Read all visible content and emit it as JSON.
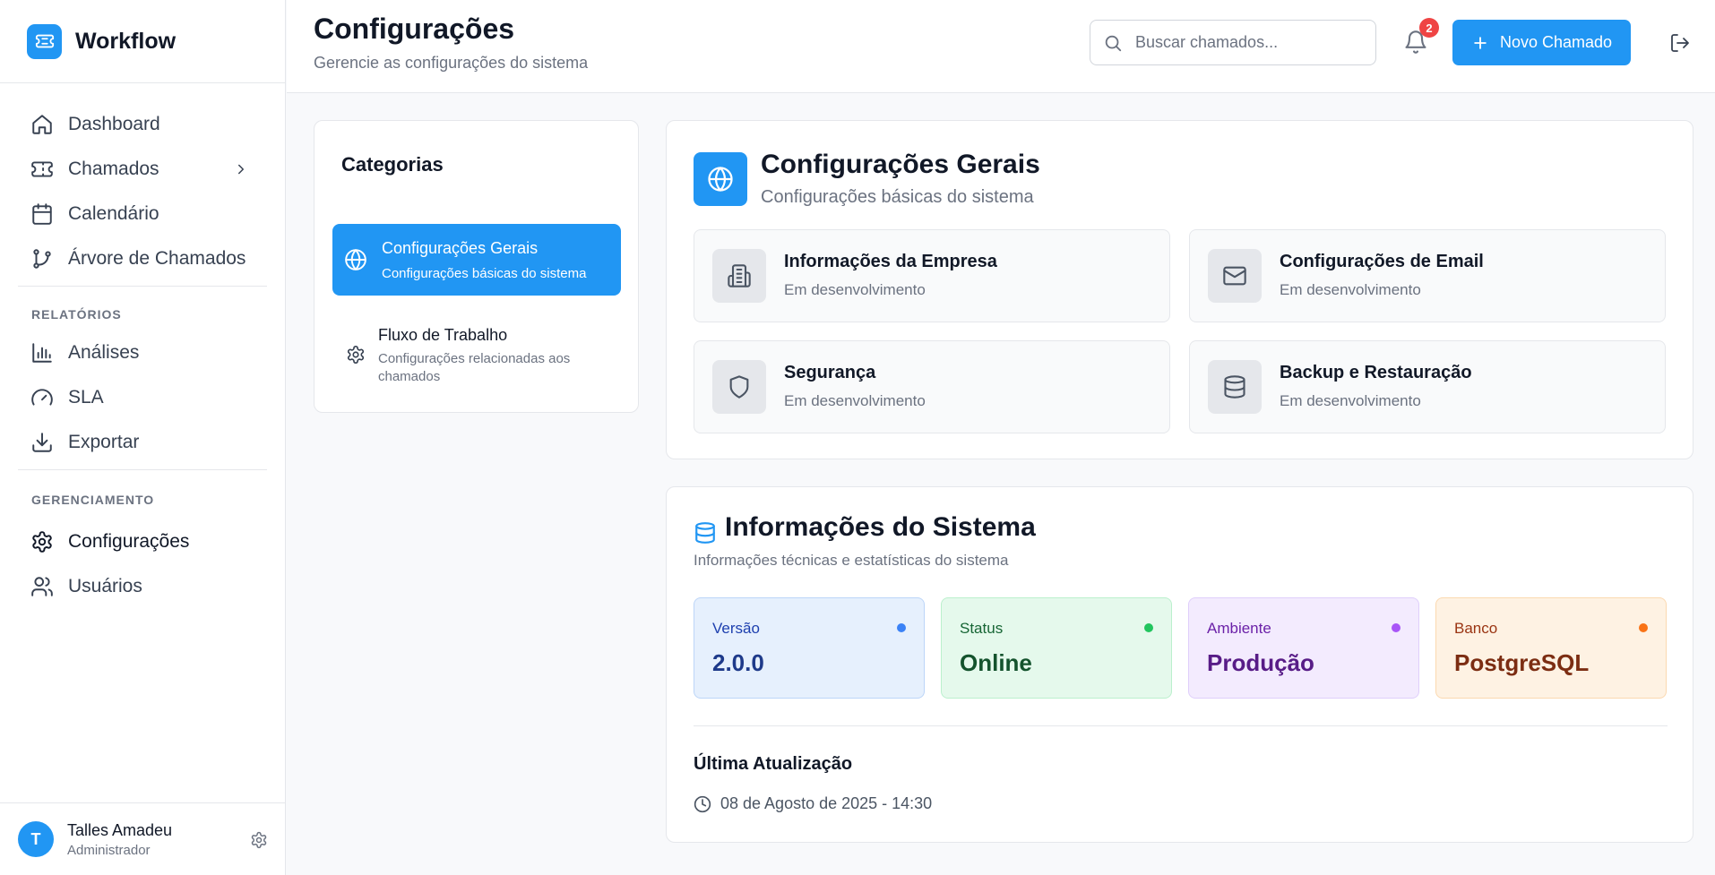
{
  "brand": {
    "name": "Workflow",
    "icon": "ticket-icon"
  },
  "sidebar": {
    "items": [
      {
        "label": "Dashboard",
        "icon": "home-icon"
      },
      {
        "label": "Chamados",
        "icon": "ticket-icon"
      },
      {
        "label": "Calendário",
        "icon": "calendar-icon"
      },
      {
        "label": "Árvore de Chamados",
        "icon": "git-branch-icon"
      }
    ],
    "reports_section": "RELATÓRIOS",
    "reports": [
      {
        "label": "Análises",
        "icon": "bar-chart-icon"
      },
      {
        "label": "SLA",
        "icon": "gauge-icon"
      },
      {
        "label": "Exportar",
        "icon": "download-icon"
      }
    ],
    "management_section": "GERENCIAMENTO",
    "management": [
      {
        "label": "Configurações",
        "icon": "gear-icon",
        "active": true
      },
      {
        "label": "Usuários",
        "icon": "users-icon"
      }
    ]
  },
  "user": {
    "initial": "T",
    "name": "Talles Amadeu",
    "role": "Administrador"
  },
  "header": {
    "title": "Configurações",
    "subtitle": "Gerencie as configurações do sistema",
    "search_placeholder": "Buscar chamados...",
    "notification_count": "2",
    "new_button": "Novo Chamado"
  },
  "categories": {
    "title": "Categorias",
    "items": [
      {
        "name": "Configurações Gerais",
        "desc": "Configurações básicas do sistema",
        "icon": "globe-icon",
        "active": true
      },
      {
        "name": "Fluxo de Trabalho",
        "desc": "Configurações relacionadas aos chamados",
        "icon": "gear-icon"
      }
    ]
  },
  "general": {
    "title": "Configurações Gerais",
    "subtitle": "Configurações básicas do sistema",
    "options": [
      {
        "title": "Informações da Empresa",
        "status": "Em desenvolvimento",
        "icon": "building-icon"
      },
      {
        "title": "Configurações de Email",
        "status": "Em desenvolvimento",
        "icon": "mail-icon"
      },
      {
        "title": "Segurança",
        "status": "Em desenvolvimento",
        "icon": "shield-icon"
      },
      {
        "title": "Backup e Restauração",
        "status": "Em desenvolvimento",
        "icon": "database-icon"
      }
    ]
  },
  "system": {
    "title": "Informações do Sistema",
    "subtitle": "Informações técnicas e estatísticas do sistema",
    "stats": [
      {
        "label": "Versão",
        "value": "2.0.0",
        "color": "#3b82f6"
      },
      {
        "label": "Status",
        "value": "Online",
        "color": "#22c55e"
      },
      {
        "label": "Ambiente",
        "value": "Produção",
        "color": "#a855f7"
      },
      {
        "label": "Banco",
        "value": "PostgreSQL",
        "color": "#f97316"
      }
    ],
    "last_update_title": "Última Atualização",
    "last_update_value": "08 de Agosto de 2025 - 14:30"
  },
  "colors": {
    "accent": "#2196f3",
    "badge": "#ef4444"
  }
}
